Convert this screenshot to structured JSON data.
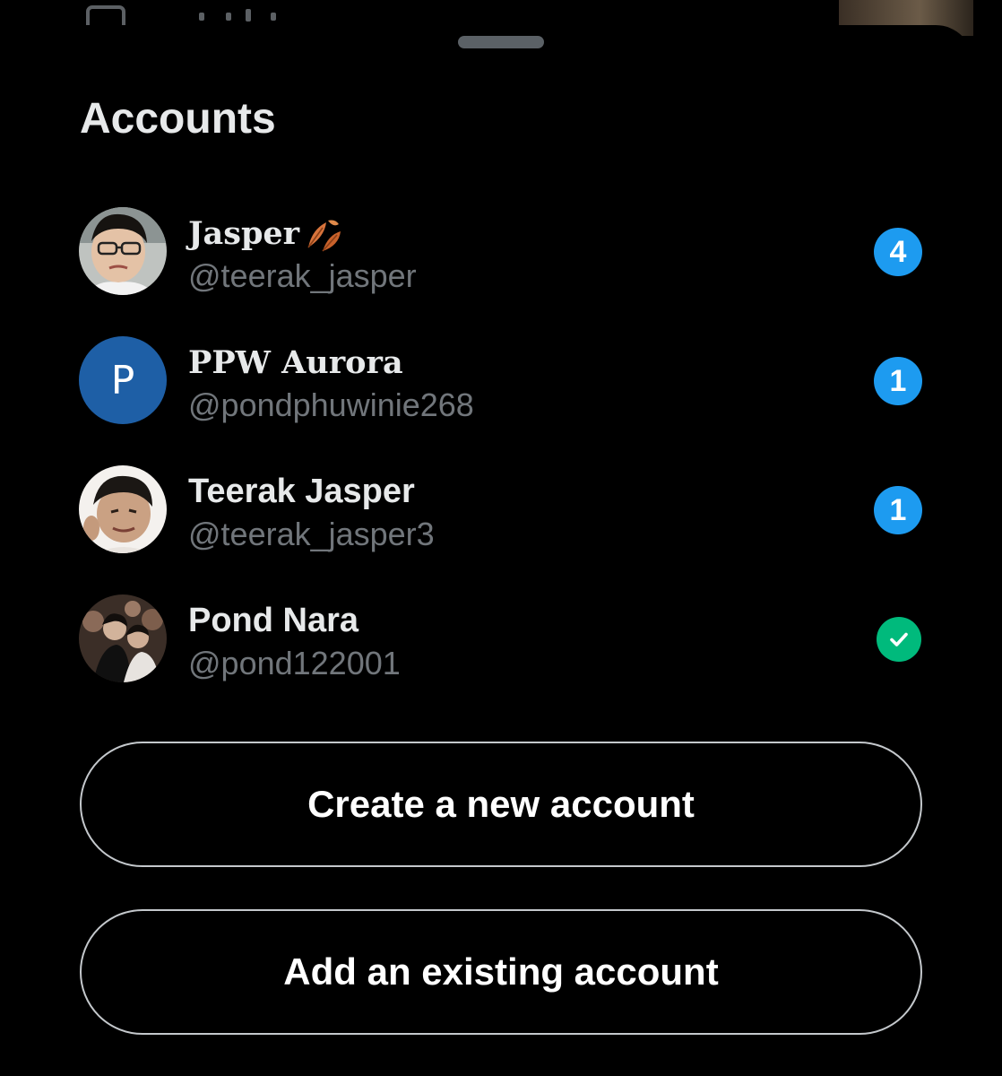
{
  "sheet": {
    "title": "Accounts"
  },
  "accounts": [
    {
      "display_name": "Jasper",
      "emoji": "fallen-leaf-emoji",
      "handle": "@teerak_jasper",
      "badge": "4",
      "avatar": "photo"
    },
    {
      "display_name": "PPW Aurora",
      "handle": "@pondphuwinie268",
      "badge": "1",
      "avatar_letter": "P",
      "avatar_color": "#1e5fa6"
    },
    {
      "display_name": "Teerak Jasper",
      "handle": "@teerak_jasper3",
      "badge": "1",
      "avatar": "photo"
    },
    {
      "display_name": "Pond Nara",
      "handle": "@pond122001",
      "status": "active-account-check-icon",
      "avatar": "photo"
    }
  ],
  "actions": {
    "create_label": "Create a new account",
    "add_label": "Add an existing account"
  },
  "colors": {
    "background": "#000000",
    "badge_blue": "#1d9bf0",
    "check_green": "#00ba7c",
    "handle_gray": "#71767b",
    "text_primary": "#e7e9ea"
  }
}
